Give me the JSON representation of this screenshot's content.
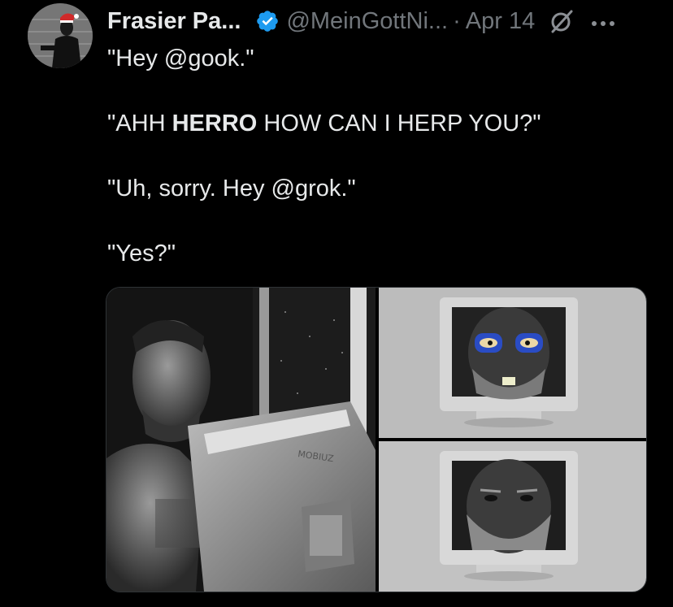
{
  "user": {
    "display_name": "Frasier Pa...",
    "handle": "@MeinGottNi...",
    "separator": "·",
    "date": "Apr 14",
    "verified": true
  },
  "tweet": {
    "line1": "\"Hey @gook.\"",
    "line2_prefix": "\"AHH ",
    "line2_bold": "HERRO",
    "line2_suffix": " HOW CAN I HERP YOU?\"",
    "line3": "\"Uh, sorry. Hey @grok.\"",
    "line4": "\"Yes?\""
  },
  "media": {
    "monitor_brand": "MOBIUZ"
  },
  "icons": {
    "avatar": "avatar-icon",
    "verified": "verified-badge-icon",
    "grok": "grok-icon",
    "more": "more-icon"
  },
  "colors": {
    "background": "#000000",
    "text": "#e7e9ea",
    "secondary": "#71767b",
    "verified": "#1d9bf0"
  }
}
